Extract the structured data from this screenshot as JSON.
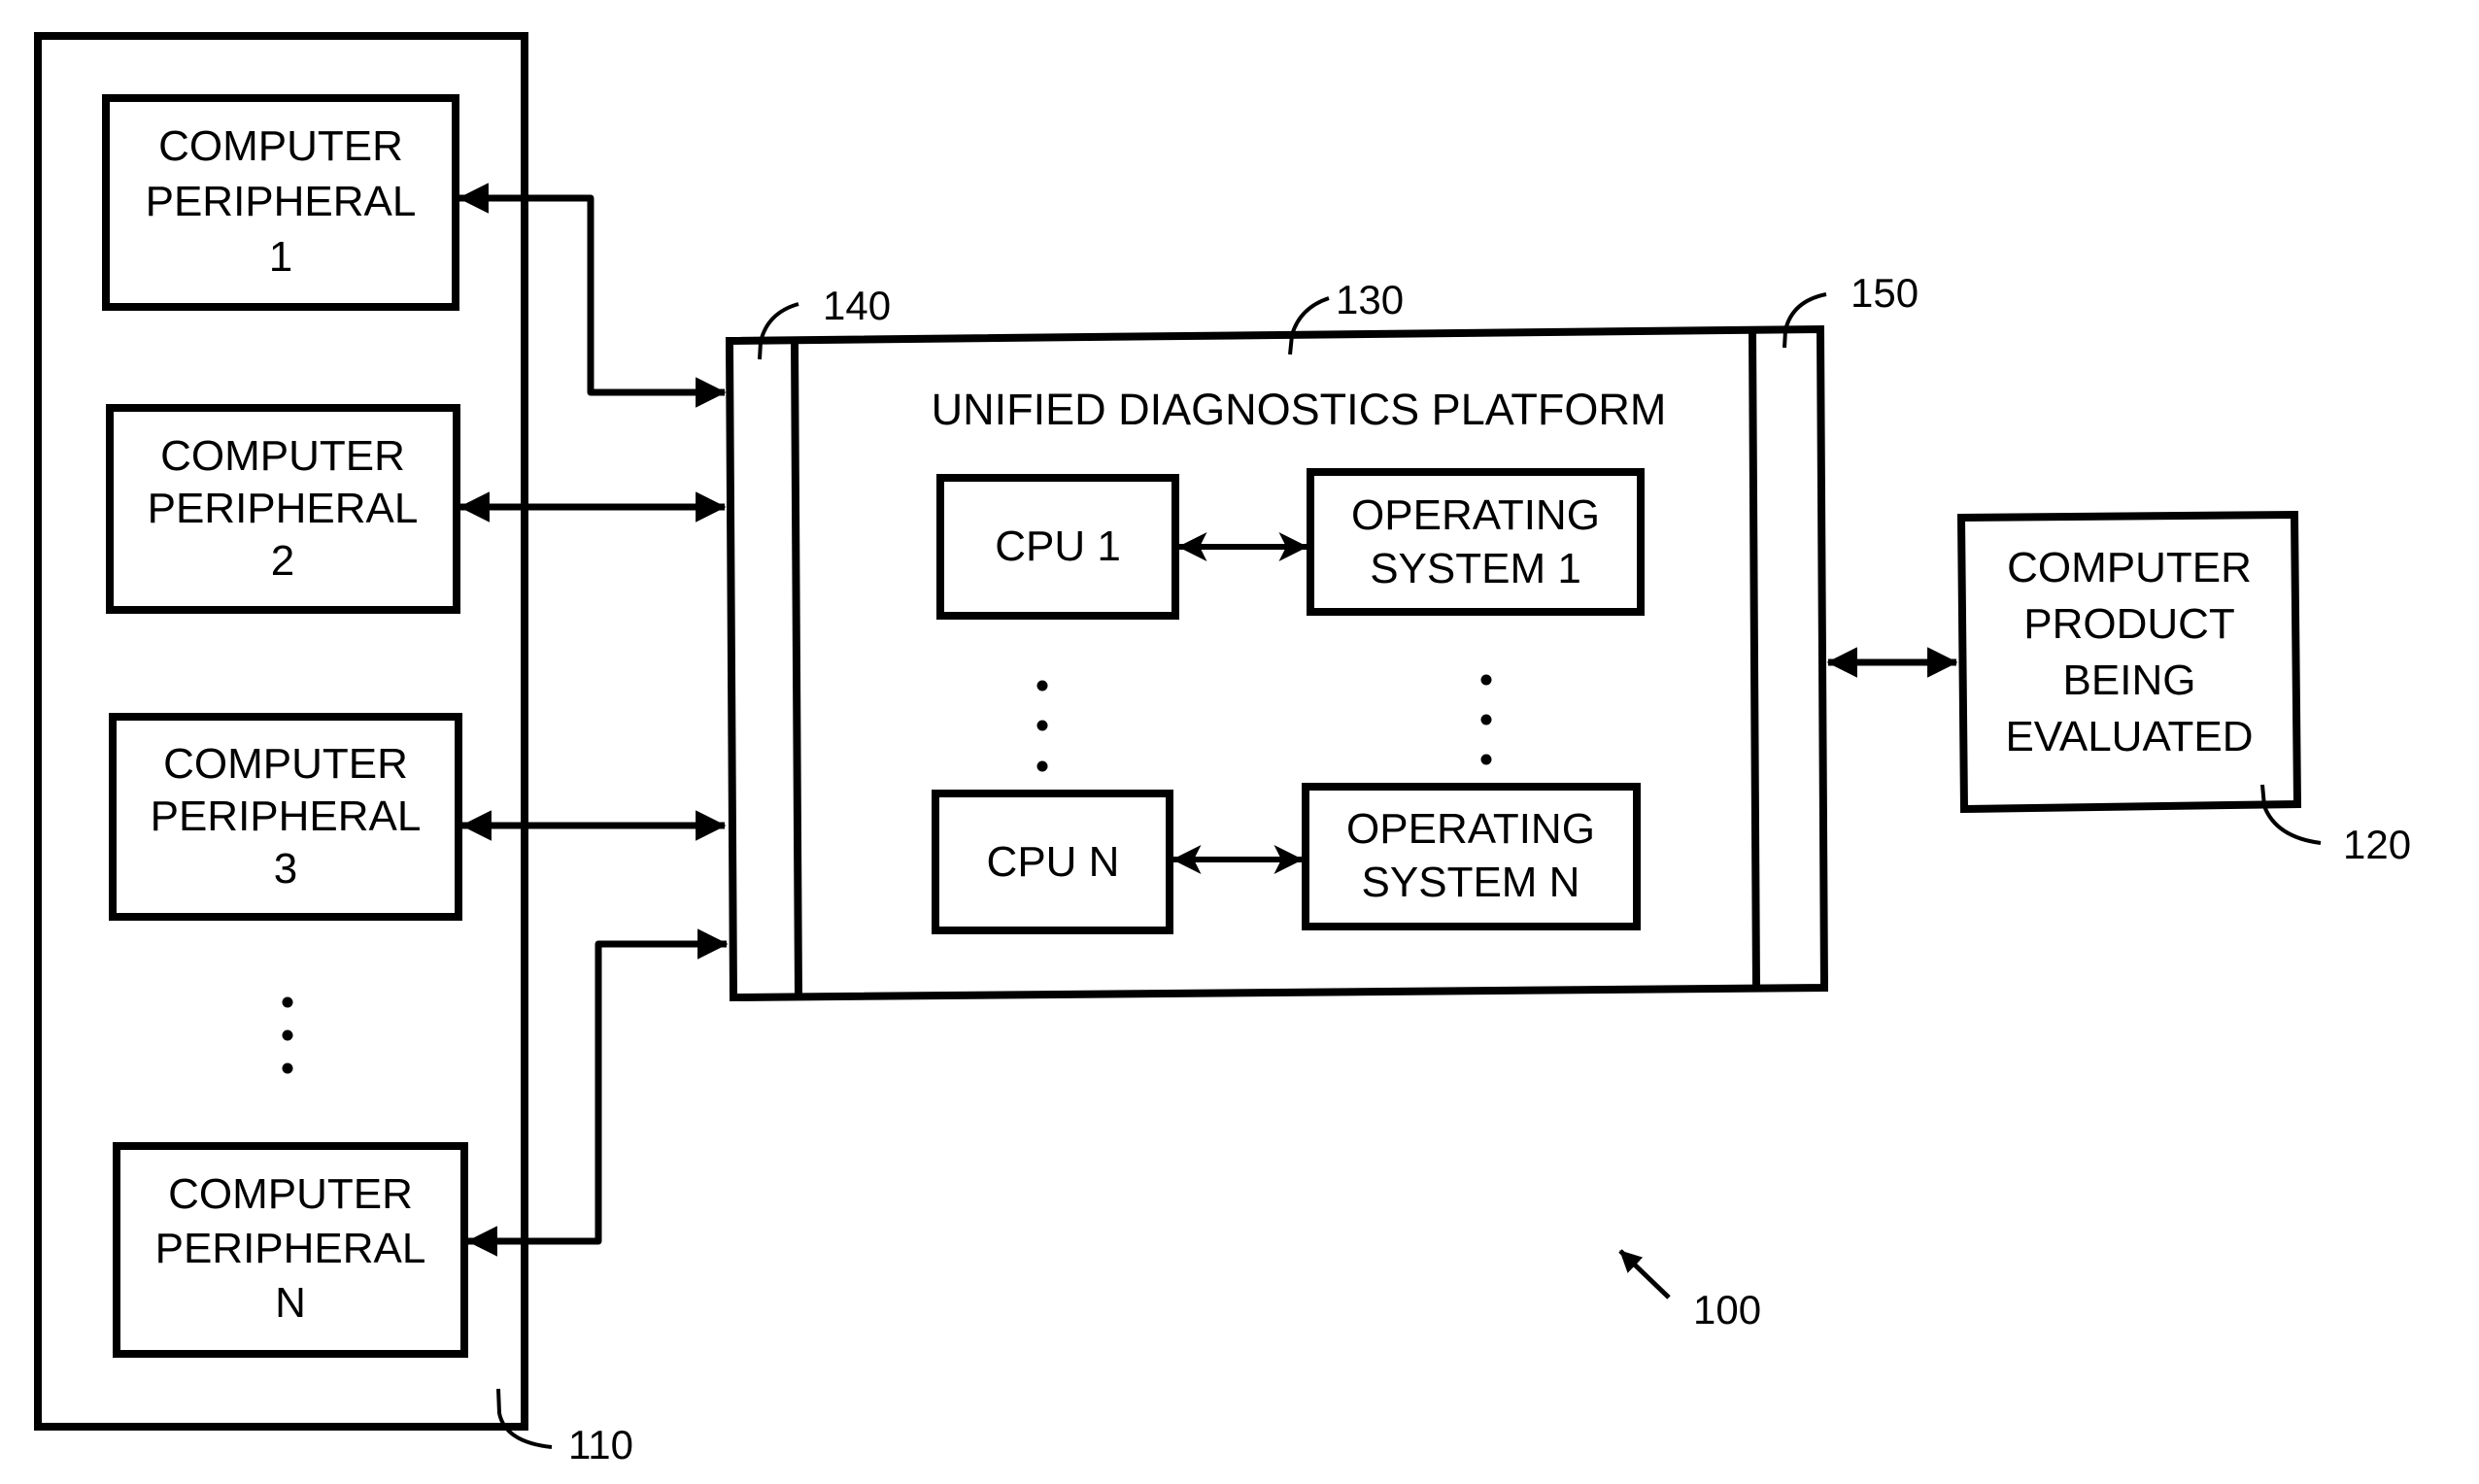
{
  "figure": {
    "reference": "100",
    "peripheral_group": {
      "reference": "110",
      "peripherals": [
        {
          "lines": [
            "COMPUTER",
            "PERIPHERAL",
            "1"
          ]
        },
        {
          "lines": [
            "COMPUTER",
            "PERIPHERAL",
            "2"
          ]
        },
        {
          "lines": [
            "COMPUTER",
            "PERIPHERAL",
            "3"
          ]
        },
        {
          "lines": [
            "COMPUTER",
            "PERIPHERAL",
            "N"
          ]
        }
      ],
      "ellipsis": "..."
    },
    "platform": {
      "reference": "130",
      "title": "UNIFIED DIAGNOSTICS PLATFORM",
      "left_interface_reference": "140",
      "right_interface_reference": "150",
      "cpus": [
        {
          "label": "CPU 1"
        },
        {
          "label": "CPU N"
        }
      ],
      "operating_systems": [
        {
          "lines": [
            "OPERATING",
            "SYSTEM 1"
          ]
        },
        {
          "lines": [
            "OPERATING",
            "SYSTEM N"
          ]
        }
      ]
    },
    "product": {
      "reference": "120",
      "lines": [
        "COMPUTER",
        "PRODUCT",
        "BEING",
        "EVALUATED"
      ]
    },
    "colors": {
      "ink": "#000000",
      "paper": "#ffffff"
    }
  }
}
